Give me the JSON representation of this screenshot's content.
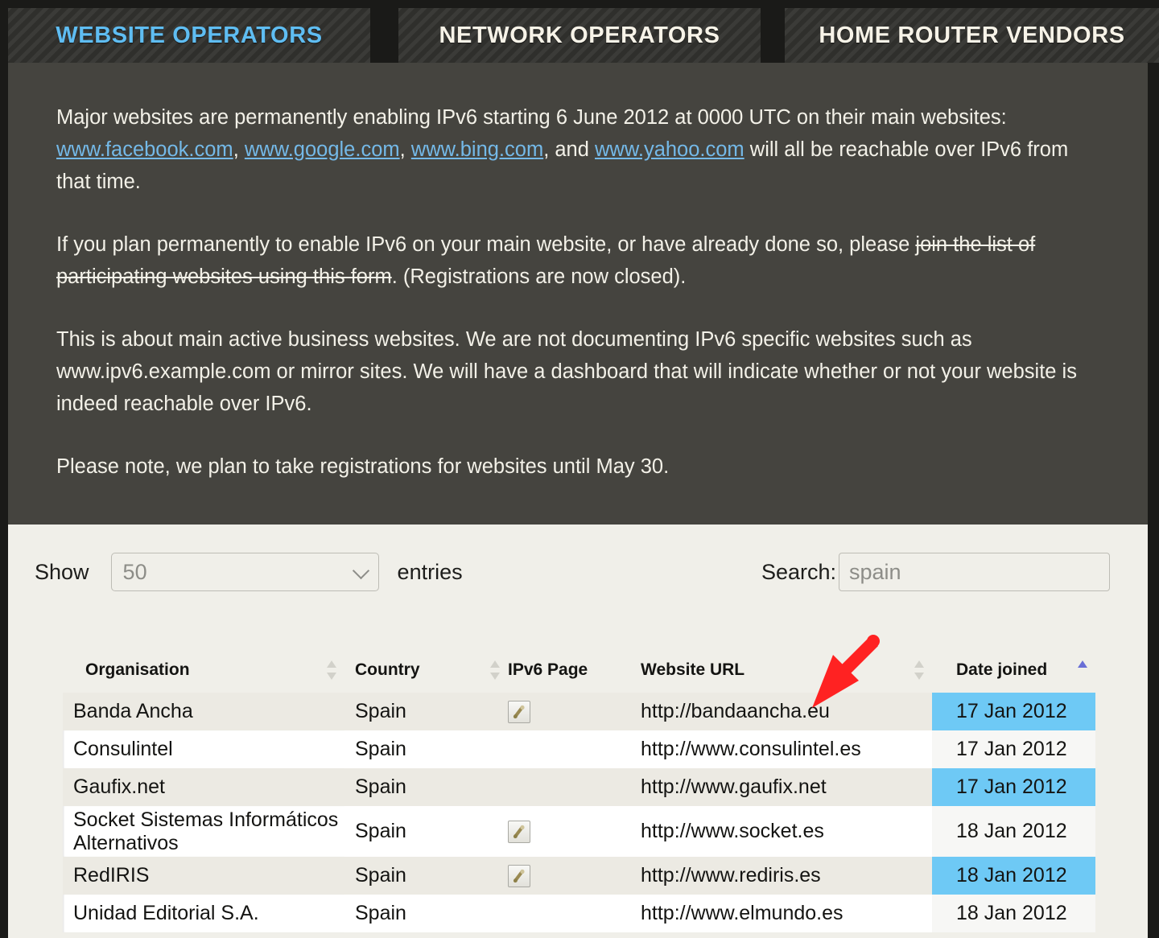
{
  "tabs": [
    {
      "label": "WEBSITE OPERATORS",
      "active": true
    },
    {
      "label": "NETWORK OPERATORS",
      "active": false
    },
    {
      "label": "HOME ROUTER VENDORS",
      "active": false
    }
  ],
  "intro": {
    "p1_before": "Major websites are permanently enabling IPv6 starting 6 June 2012 at 0000 UTC on their main websites: ",
    "link_facebook": "www.facebook.com",
    "sep1": ", ",
    "link_google": "www.google.com",
    "sep2": ", ",
    "link_bing": "www.bing.com",
    "sep3": ", and ",
    "link_yahoo": "www.yahoo.com",
    "p1_after": " will all be reachable over IPv6 from that time.",
    "p2_before": "If you plan permanently to enable IPv6 on your main website, or have already done so, please ",
    "p2_struck": "join the list of participating websites using this form",
    "p2_after": ". (Registrations are now closed).",
    "p3": "This is about main active business websites. We are not documenting IPv6 specific websites such as www.ipv6.example.com or mirror sites. We will have a dashboard that will indicate whether or not your website is indeed reachable over IPv6.",
    "p4": "Please note, we plan to take registrations for websites until May 30."
  },
  "controls": {
    "show_label": "Show",
    "entries_label": "entries",
    "page_length_value": "50",
    "page_length_options": [
      "50"
    ],
    "search_label": "Search:",
    "search_value": "spain",
    "search_placeholder": "spain"
  },
  "table": {
    "columns": [
      {
        "key": "organisation",
        "label": "Organisation",
        "sortable": true,
        "sorted": "none"
      },
      {
        "key": "country",
        "label": "Country",
        "sortable": true,
        "sorted": "none"
      },
      {
        "key": "ipv6_page",
        "label": "IPv6 Page",
        "sortable": false,
        "sorted": "none"
      },
      {
        "key": "website_url",
        "label": "Website URL",
        "sortable": true,
        "sorted": "none"
      },
      {
        "key": "date_joined",
        "label": "Date joined",
        "sortable": true,
        "sorted": "asc"
      }
    ],
    "rows": [
      {
        "organisation": "Banda Ancha",
        "country": "Spain",
        "ipv6_page": "link-icon",
        "website_url": "http://bandaancha.eu",
        "date_joined": "17 Jan 2012"
      },
      {
        "organisation": "Consulintel",
        "country": "Spain",
        "ipv6_page": "",
        "website_url": "http://www.consulintel.es",
        "date_joined": "17 Jan 2012"
      },
      {
        "organisation": "Gaufix.net",
        "country": "Spain",
        "ipv6_page": "",
        "website_url": "http://www.gaufix.net",
        "date_joined": "17 Jan 2012"
      },
      {
        "organisation": "Socket Sistemas Informáticos Alternativos",
        "country": "Spain",
        "ipv6_page": "link-icon",
        "website_url": "http://www.socket.es",
        "date_joined": "18 Jan 2012"
      },
      {
        "organisation": "RedIRIS",
        "country": "Spain",
        "ipv6_page": "link-icon",
        "website_url": "http://www.rediris.es",
        "date_joined": "18 Jan 2012"
      },
      {
        "organisation": "Unidad Editorial S.A.",
        "country": "Spain",
        "ipv6_page": "",
        "website_url": "http://www.elmundo.es",
        "date_joined": "18 Jan 2012"
      }
    ]
  },
  "annotation": {
    "arrow_color": "#ff2222",
    "points_to": "http://bandaancha.eu"
  },
  "colors": {
    "tab_active_text": "#5fbdf2",
    "tab_inactive_text": "#f7f3e8",
    "panel_dark": "#45443f",
    "panel_light": "#f0efe9",
    "link": "#74b9e8",
    "sorted_cell": "#6ec9f5",
    "sort_active_arrow": "#6a6fd6"
  }
}
